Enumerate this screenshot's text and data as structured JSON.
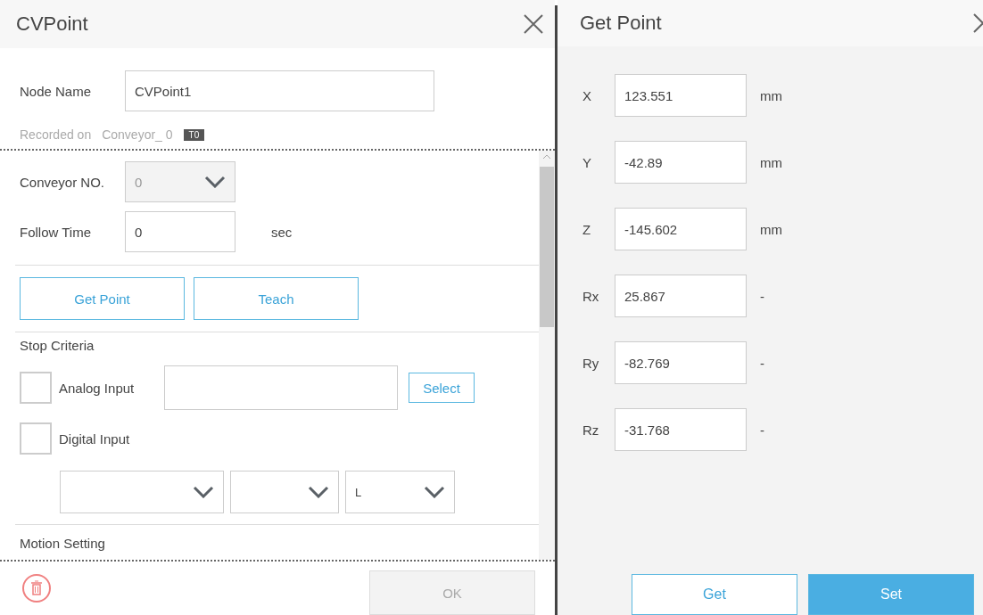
{
  "cv_dialog": {
    "title": "CVPoint",
    "node_name": {
      "label": "Node Name",
      "value": "CVPoint1"
    },
    "recorded": {
      "label": "Recorded on",
      "conveyor": "Conveyor_ 0",
      "badge": "T0"
    },
    "conveyor_no": {
      "label": "Conveyor NO.",
      "value": "0",
      "disabled": true
    },
    "follow_time": {
      "label": "Follow Time",
      "value": "0",
      "unit": "sec"
    },
    "buttons": [
      "Get Point",
      "Teach"
    ],
    "stop_criteria": {
      "title": "Stop Criteria",
      "analog": {
        "label": "Analog Input",
        "checked": false,
        "button": "Select"
      },
      "digital": {
        "label": "Digital Input",
        "checked": false,
        "dropdowns": [
          {
            "kind": "blank"
          },
          {
            "kind": "blank"
          },
          {
            "kind": "filled",
            "value": "L"
          }
        ]
      }
    },
    "motion_setting": "Motion Setting",
    "ok_button": {
      "label": "OK",
      "disabled": true
    }
  },
  "get_point_dialog": {
    "title": "Get Point",
    "rows": [
      {
        "label": "X",
        "value": "123.551",
        "unit": "mm"
      },
      {
        "label": "Y",
        "value": "-42.89",
        "unit": "mm"
      },
      {
        "label": "Z",
        "value": "-145.602",
        "unit": "mm"
      },
      {
        "label": "Rx",
        "value": "25.867",
        "unit": "-"
      },
      {
        "label": "Ry",
        "value": "-82.769",
        "unit": "-"
      },
      {
        "label": "Rz",
        "value": "-31.768",
        "unit": "-"
      }
    ],
    "buttons": [
      {
        "label": "Get",
        "kind": "secondary"
      },
      {
        "label": "Set",
        "kind": "primary"
      }
    ]
  }
}
